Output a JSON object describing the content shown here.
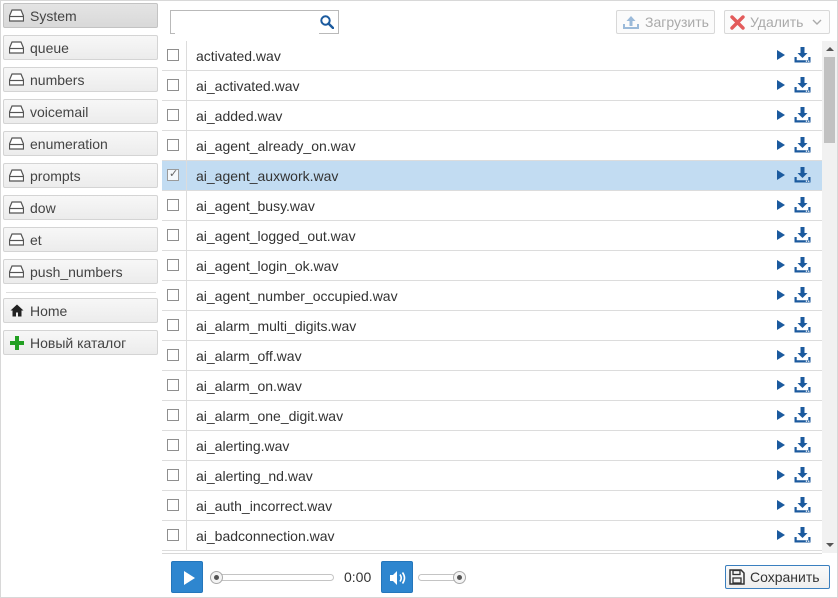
{
  "sidebar": {
    "folders": [
      {
        "label": "System",
        "active": true
      },
      {
        "label": "queue"
      },
      {
        "label": "numbers"
      },
      {
        "label": "voicemail"
      },
      {
        "label": "enumeration"
      },
      {
        "label": "prompts"
      },
      {
        "label": "dow"
      },
      {
        "label": "et"
      },
      {
        "label": "push_numbers"
      }
    ],
    "home_label": "Home",
    "new_folder_label": "Новый каталог"
  },
  "toolbar": {
    "search_value": "",
    "upload_label": "Загрузить",
    "delete_label": "Удалить"
  },
  "files": [
    {
      "name": "activated.wav",
      "checked": false
    },
    {
      "name": "ai_activated.wav",
      "checked": false
    },
    {
      "name": "ai_added.wav",
      "checked": false
    },
    {
      "name": "ai_agent_already_on.wav",
      "checked": false
    },
    {
      "name": "ai_agent_auxwork.wav",
      "checked": true
    },
    {
      "name": "ai_agent_busy.wav",
      "checked": false
    },
    {
      "name": "ai_agent_logged_out.wav",
      "checked": false
    },
    {
      "name": "ai_agent_login_ok.wav",
      "checked": false
    },
    {
      "name": "ai_agent_number_occupied.wav",
      "checked": false
    },
    {
      "name": "ai_alarm_multi_digits.wav",
      "checked": false
    },
    {
      "name": "ai_alarm_off.wav",
      "checked": false
    },
    {
      "name": "ai_alarm_on.wav",
      "checked": false
    },
    {
      "name": "ai_alarm_one_digit.wav",
      "checked": false
    },
    {
      "name": "ai_alerting.wav",
      "checked": false
    },
    {
      "name": "ai_alerting_nd.wav",
      "checked": false
    },
    {
      "name": "ai_auth_incorrect.wav",
      "checked": false
    },
    {
      "name": "ai_badconnection.wav",
      "checked": false
    }
  ],
  "player": {
    "time": "0:00",
    "progress": 0,
    "volume": 1.0,
    "save_label": "Сохранить"
  },
  "colors": {
    "accent": "#2e86cf",
    "selected_row": "#c2dcf2",
    "icon_blue": "#1b5a9e",
    "delete_red": "#e35b5b",
    "new_green": "#22a022"
  }
}
